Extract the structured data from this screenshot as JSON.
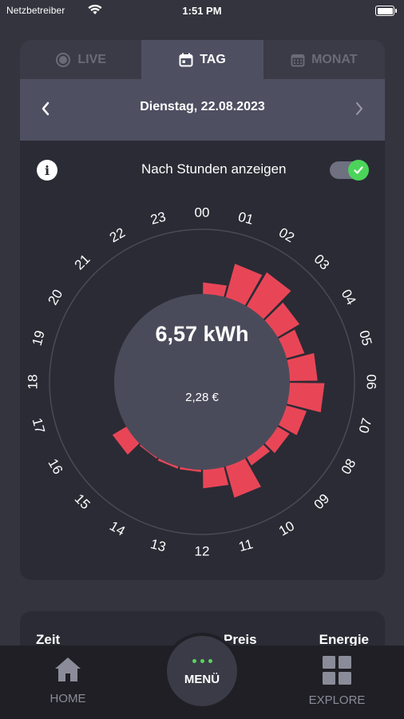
{
  "status": {
    "carrier": "Netzbetreiber",
    "time": "1:51 PM"
  },
  "tabs": [
    {
      "label": "LIVE",
      "icon": "live-dot-icon",
      "active": false
    },
    {
      "label": "TAG",
      "icon": "calendar-day-icon",
      "active": true
    },
    {
      "label": "MONAT",
      "icon": "calendar-month-icon",
      "active": false
    }
  ],
  "date_nav": {
    "date": "Dienstag, 22.08.2023"
  },
  "toggle": {
    "label": "Nach Stunden anzeigen",
    "on": true
  },
  "summary": {
    "energy": "6,57 kWh",
    "cost": "2,28 €"
  },
  "chart_data": {
    "type": "polar-bar",
    "hours": [
      "00",
      "01",
      "02",
      "03",
      "04",
      "05",
      "06",
      "07",
      "08",
      "09",
      "10",
      "11",
      "12",
      "13",
      "14",
      "15",
      "16",
      "17",
      "18",
      "19",
      "20",
      "21",
      "22",
      "23"
    ],
    "values": [
      0.25,
      0.75,
      0.85,
      0.55,
      0.4,
      0.6,
      0.75,
      0.45,
      0.3,
      0.2,
      0.7,
      0.4,
      0.05,
      0.05,
      0.03,
      0.35,
      0,
      0,
      0,
      0,
      0,
      0,
      0,
      0
    ],
    "color": "#e84657"
  },
  "table": {
    "col_time": "Zeit",
    "col_price": "Preis",
    "col_energy": "Energie"
  },
  "nav": {
    "home": "HOME",
    "menu": "MENÜ",
    "explore": "EXPLORE"
  }
}
